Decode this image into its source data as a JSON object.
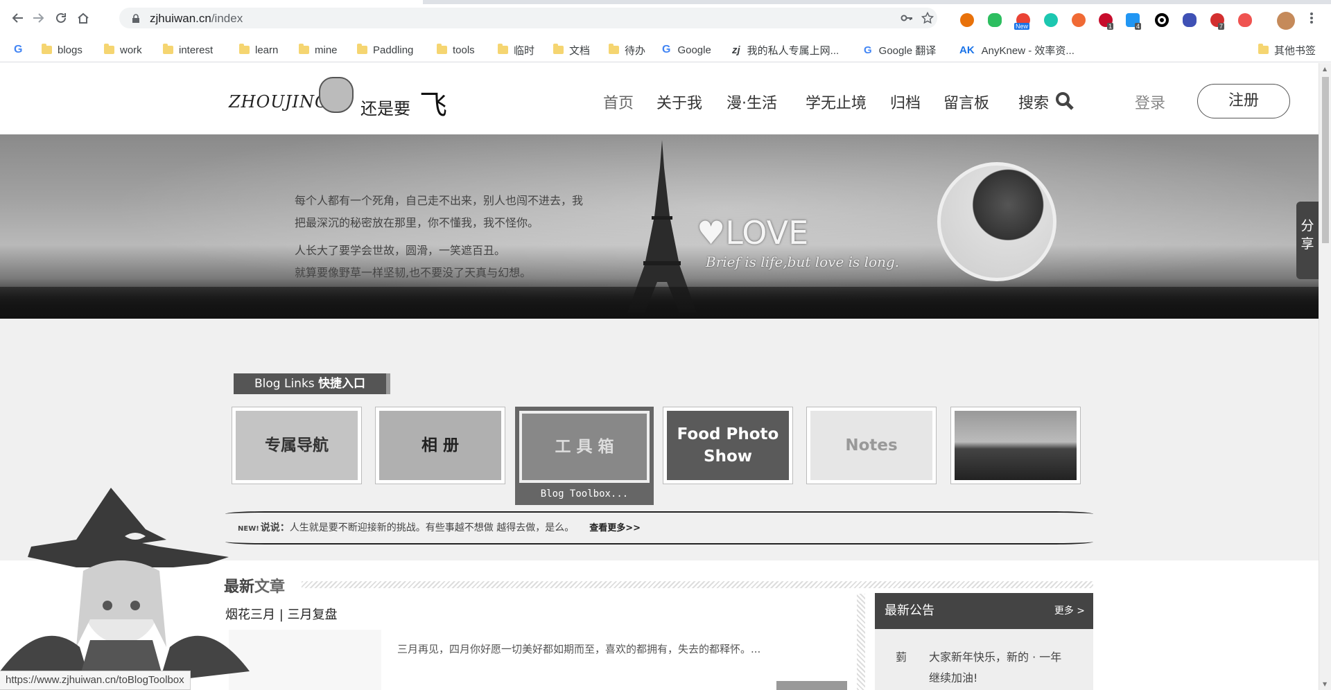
{
  "browser": {
    "url_host": "zjhuiwan.cn",
    "url_path": "/index",
    "bookmarks": [
      {
        "label": "blogs",
        "icon": "folder"
      },
      {
        "label": "work",
        "icon": "folder"
      },
      {
        "label": "interest",
        "icon": "folder"
      },
      {
        "label": "learn",
        "icon": "folder"
      },
      {
        "label": "mine",
        "icon": "folder"
      },
      {
        "label": "Paddling",
        "icon": "folder"
      },
      {
        "label": "tools",
        "icon": "folder"
      },
      {
        "label": "临时",
        "icon": "folder"
      },
      {
        "label": "文档",
        "icon": "folder"
      },
      {
        "label": "待办",
        "icon": "folder"
      },
      {
        "label": "Google",
        "icon": "google"
      },
      {
        "label": "我的私人专属上网...",
        "icon": "zj"
      },
      {
        "label": "Google 翻译",
        "icon": "translate"
      },
      {
        "label": "AnyKnew - 效率资...",
        "icon": "ak"
      }
    ],
    "other_bookmarks": "其他书签",
    "extension_badges": {
      "new": "New",
      "abp": "1",
      "ext4": "4",
      "ext7": "7"
    },
    "status_url": "https://www.zjhuiwan.cn/toBlogToolbox"
  },
  "site": {
    "logo_en": "ZHOUJING",
    "logo_zh": "还是要",
    "logo_fei": "飞",
    "nav": [
      "首页",
      "关于我",
      "漫·生活",
      "学无止境",
      "归档",
      "留言板",
      "搜索"
    ],
    "login": "登录",
    "register": "注册",
    "share": "分享"
  },
  "banner": {
    "para1": "每个人都有一个死角，自己走不出来，别人也闯不进去，我把最深沉的秘密放在那里，你不懂我，我不怪你。",
    "para2": "人长大了要学会世故，圆滑，一笑遮百丑。",
    "para3": "就算要像野草一样坚韧,也不要没了天真与幻想。",
    "love": "LOVE",
    "love_sub": "Brief is life,but love is long."
  },
  "quicklinks": {
    "title_en": "Blog Links",
    "title_cn": "快捷入口",
    "tiles": [
      {
        "label": "专属导航"
      },
      {
        "label": "相 册"
      },
      {
        "label": "工 具 箱",
        "caption": "Blog Toolbox..."
      },
      {
        "label": "Food Photo Show"
      },
      {
        "label": "Notes"
      },
      {
        "label": ""
      }
    ]
  },
  "shuo": {
    "new": "NEW!",
    "label": "说说：",
    "text": "人生就是要不断迎接新的挑战。有些事越不想做 越得去做，是么。",
    "more": "查看更多>>"
  },
  "latest": {
    "title_a": "最新",
    "title_b": "文章",
    "post_title": "烟花三月 | 三月复盘",
    "post_excerpt": "三月再见，四月你好愿一切美好都如期而至，喜欢的都拥有，失去的都释怀。...",
    "notice_title": "最新公告",
    "notice_more": "更多 >",
    "notice_tag": "菿 ",
    "notice_body": "大家新年快乐，新的 · 一年继续加油!"
  },
  "colors": {
    "accent": "#444444",
    "page_bg": "#f0f0f0"
  }
}
